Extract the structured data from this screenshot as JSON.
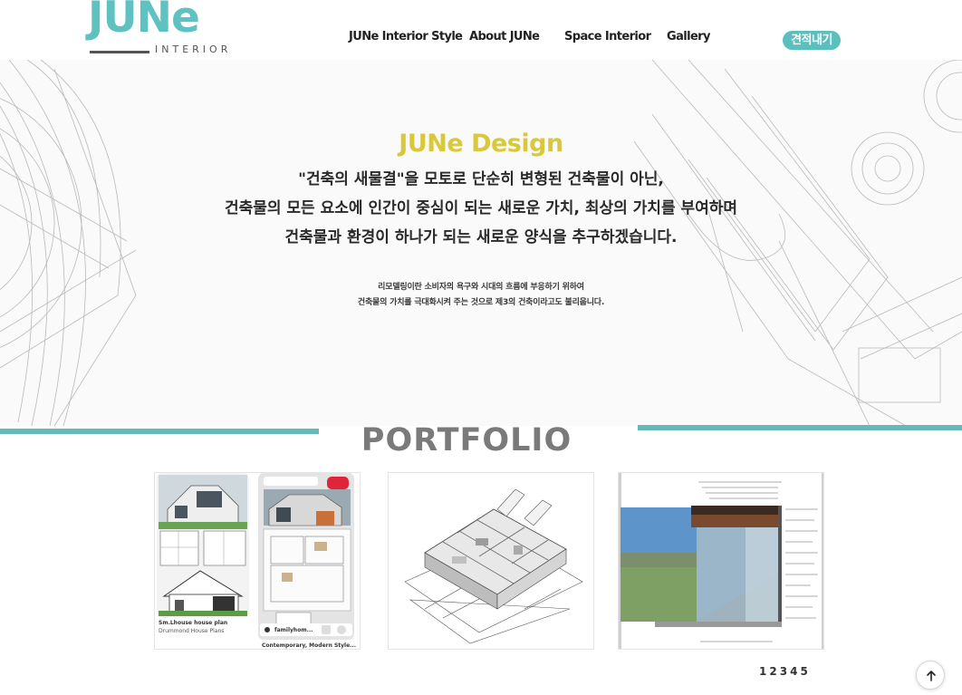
{
  "header": {
    "logo": {
      "main": "JUNe",
      "sub": "INTERIOR"
    },
    "nav": [
      "JUNe  Interior Style",
      "About JUNe",
      "Space Interior",
      "Gallery"
    ],
    "quote_button": "견적내기"
  },
  "hero": {
    "title": "JUNe Design",
    "lines": [
      "\"건축의 새물결\"을 모토로 단순히 변형된 건축물이 아닌,",
      "건축물의 모든 요소에 인간이 중심이 되는 새로운 가치, 최상의 가치를 부여하며",
      "건축물과 환경이 하나가 되는 새로운 양식을 추구하겠습니다."
    ],
    "small_lines": [
      "리모델링이란 소비자의 욕구와 시대의 흐름에 부응하기 위하여",
      "건축물의 가치를 극대화시켜 주는 것으로 제3의 건축이라고도 불리웁니다."
    ]
  },
  "portfolio": {
    "title": "PORTFOLIO",
    "cards": [
      {
        "name": "house-plans-pin",
        "captions": {
          "left_title": "Sm.Lhouse house plan",
          "left_sub": "Drummond House Plans",
          "pin_source": "familyhom...",
          "bottom": "Contemporary, Modern Style..."
        }
      },
      {
        "name": "3d-floor-plan"
      },
      {
        "name": "architectural-section"
      }
    ],
    "pager": [
      "1",
      "2",
      "3",
      "4",
      "5"
    ]
  },
  "colors": {
    "teal": "#5fc2c1",
    "gold": "#d8c83a",
    "rule": "#66b9ba"
  },
  "icons": {
    "back_to_top": "arrow-up-icon"
  }
}
